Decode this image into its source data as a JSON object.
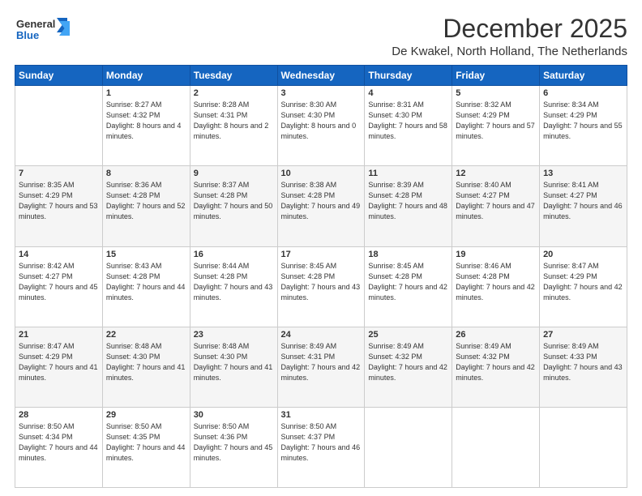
{
  "logo": {
    "general": "General",
    "blue": "Blue"
  },
  "title": "December 2025",
  "subtitle": "De Kwakel, North Holland, The Netherlands",
  "days_header": [
    "Sunday",
    "Monday",
    "Tuesday",
    "Wednesday",
    "Thursday",
    "Friday",
    "Saturday"
  ],
  "weeks": [
    [
      {
        "num": "",
        "sunrise": "",
        "sunset": "",
        "daylight": ""
      },
      {
        "num": "1",
        "sunrise": "Sunrise: 8:27 AM",
        "sunset": "Sunset: 4:32 PM",
        "daylight": "Daylight: 8 hours and 4 minutes."
      },
      {
        "num": "2",
        "sunrise": "Sunrise: 8:28 AM",
        "sunset": "Sunset: 4:31 PM",
        "daylight": "Daylight: 8 hours and 2 minutes."
      },
      {
        "num": "3",
        "sunrise": "Sunrise: 8:30 AM",
        "sunset": "Sunset: 4:30 PM",
        "daylight": "Daylight: 8 hours and 0 minutes."
      },
      {
        "num": "4",
        "sunrise": "Sunrise: 8:31 AM",
        "sunset": "Sunset: 4:30 PM",
        "daylight": "Daylight: 7 hours and 58 minutes."
      },
      {
        "num": "5",
        "sunrise": "Sunrise: 8:32 AM",
        "sunset": "Sunset: 4:29 PM",
        "daylight": "Daylight: 7 hours and 57 minutes."
      },
      {
        "num": "6",
        "sunrise": "Sunrise: 8:34 AM",
        "sunset": "Sunset: 4:29 PM",
        "daylight": "Daylight: 7 hours and 55 minutes."
      }
    ],
    [
      {
        "num": "7",
        "sunrise": "Sunrise: 8:35 AM",
        "sunset": "Sunset: 4:29 PM",
        "daylight": "Daylight: 7 hours and 53 minutes."
      },
      {
        "num": "8",
        "sunrise": "Sunrise: 8:36 AM",
        "sunset": "Sunset: 4:28 PM",
        "daylight": "Daylight: 7 hours and 52 minutes."
      },
      {
        "num": "9",
        "sunrise": "Sunrise: 8:37 AM",
        "sunset": "Sunset: 4:28 PM",
        "daylight": "Daylight: 7 hours and 50 minutes."
      },
      {
        "num": "10",
        "sunrise": "Sunrise: 8:38 AM",
        "sunset": "Sunset: 4:28 PM",
        "daylight": "Daylight: 7 hours and 49 minutes."
      },
      {
        "num": "11",
        "sunrise": "Sunrise: 8:39 AM",
        "sunset": "Sunset: 4:28 PM",
        "daylight": "Daylight: 7 hours and 48 minutes."
      },
      {
        "num": "12",
        "sunrise": "Sunrise: 8:40 AM",
        "sunset": "Sunset: 4:27 PM",
        "daylight": "Daylight: 7 hours and 47 minutes."
      },
      {
        "num": "13",
        "sunrise": "Sunrise: 8:41 AM",
        "sunset": "Sunset: 4:27 PM",
        "daylight": "Daylight: 7 hours and 46 minutes."
      }
    ],
    [
      {
        "num": "14",
        "sunrise": "Sunrise: 8:42 AM",
        "sunset": "Sunset: 4:27 PM",
        "daylight": "Daylight: 7 hours and 45 minutes."
      },
      {
        "num": "15",
        "sunrise": "Sunrise: 8:43 AM",
        "sunset": "Sunset: 4:28 PM",
        "daylight": "Daylight: 7 hours and 44 minutes."
      },
      {
        "num": "16",
        "sunrise": "Sunrise: 8:44 AM",
        "sunset": "Sunset: 4:28 PM",
        "daylight": "Daylight: 7 hours and 43 minutes."
      },
      {
        "num": "17",
        "sunrise": "Sunrise: 8:45 AM",
        "sunset": "Sunset: 4:28 PM",
        "daylight": "Daylight: 7 hours and 43 minutes."
      },
      {
        "num": "18",
        "sunrise": "Sunrise: 8:45 AM",
        "sunset": "Sunset: 4:28 PM",
        "daylight": "Daylight: 7 hours and 42 minutes."
      },
      {
        "num": "19",
        "sunrise": "Sunrise: 8:46 AM",
        "sunset": "Sunset: 4:28 PM",
        "daylight": "Daylight: 7 hours and 42 minutes."
      },
      {
        "num": "20",
        "sunrise": "Sunrise: 8:47 AM",
        "sunset": "Sunset: 4:29 PM",
        "daylight": "Daylight: 7 hours and 42 minutes."
      }
    ],
    [
      {
        "num": "21",
        "sunrise": "Sunrise: 8:47 AM",
        "sunset": "Sunset: 4:29 PM",
        "daylight": "Daylight: 7 hours and 41 minutes."
      },
      {
        "num": "22",
        "sunrise": "Sunrise: 8:48 AM",
        "sunset": "Sunset: 4:30 PM",
        "daylight": "Daylight: 7 hours and 41 minutes."
      },
      {
        "num": "23",
        "sunrise": "Sunrise: 8:48 AM",
        "sunset": "Sunset: 4:30 PM",
        "daylight": "Daylight: 7 hours and 41 minutes."
      },
      {
        "num": "24",
        "sunrise": "Sunrise: 8:49 AM",
        "sunset": "Sunset: 4:31 PM",
        "daylight": "Daylight: 7 hours and 42 minutes."
      },
      {
        "num": "25",
        "sunrise": "Sunrise: 8:49 AM",
        "sunset": "Sunset: 4:32 PM",
        "daylight": "Daylight: 7 hours and 42 minutes."
      },
      {
        "num": "26",
        "sunrise": "Sunrise: 8:49 AM",
        "sunset": "Sunset: 4:32 PM",
        "daylight": "Daylight: 7 hours and 42 minutes."
      },
      {
        "num": "27",
        "sunrise": "Sunrise: 8:49 AM",
        "sunset": "Sunset: 4:33 PM",
        "daylight": "Daylight: 7 hours and 43 minutes."
      }
    ],
    [
      {
        "num": "28",
        "sunrise": "Sunrise: 8:50 AM",
        "sunset": "Sunset: 4:34 PM",
        "daylight": "Daylight: 7 hours and 44 minutes."
      },
      {
        "num": "29",
        "sunrise": "Sunrise: 8:50 AM",
        "sunset": "Sunset: 4:35 PM",
        "daylight": "Daylight: 7 hours and 44 minutes."
      },
      {
        "num": "30",
        "sunrise": "Sunrise: 8:50 AM",
        "sunset": "Sunset: 4:36 PM",
        "daylight": "Daylight: 7 hours and 45 minutes."
      },
      {
        "num": "31",
        "sunrise": "Sunrise: 8:50 AM",
        "sunset": "Sunset: 4:37 PM",
        "daylight": "Daylight: 7 hours and 46 minutes."
      },
      {
        "num": "",
        "sunrise": "",
        "sunset": "",
        "daylight": ""
      },
      {
        "num": "",
        "sunrise": "",
        "sunset": "",
        "daylight": ""
      },
      {
        "num": "",
        "sunrise": "",
        "sunset": "",
        "daylight": ""
      }
    ]
  ]
}
